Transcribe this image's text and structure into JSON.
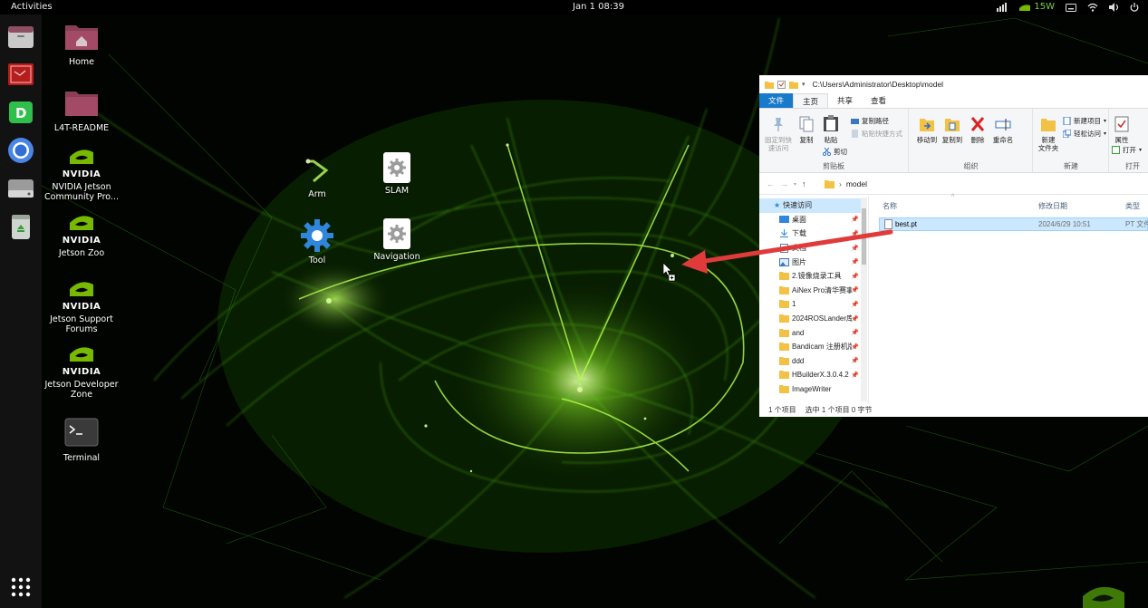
{
  "topbar": {
    "activities": "Activities",
    "clock": "Jan 1  08:39",
    "power_mode": "15W"
  },
  "dock": {
    "items": [
      "file-manager",
      "screenshot-tool",
      "dashboard-app",
      "chromium-browser",
      "drive",
      "trash"
    ],
    "show_apps": "show-apps"
  },
  "desktop": {
    "icons": [
      {
        "label": "Home"
      },
      {
        "label": "L4T-README"
      },
      {
        "label": "NVIDIA Jetson Community Pro..."
      },
      {
        "label": "Jetson Zoo"
      },
      {
        "label": "Jetson Support Forums"
      },
      {
        "label": "Jetson Developer Zone"
      },
      {
        "label": "Terminal"
      }
    ],
    "nvidia_word": "NVIDIA",
    "apps": [
      {
        "label": "Arm"
      },
      {
        "label": "SLAM"
      },
      {
        "label": "Tool"
      },
      {
        "label": "Navigation"
      }
    ]
  },
  "explorer": {
    "title_path": "C:\\Users\\Administrator\\Desktop\\model",
    "tabs": [
      "文件",
      "主页",
      "共享",
      "查看"
    ],
    "ribbon": {
      "pin_quick": "固定到快\n速访问",
      "copy": "复制",
      "paste": "粘贴",
      "copy_path": "复制路径",
      "paste_shortcut": "粘贴快捷方式",
      "cut": "剪切",
      "group_clipboard": "剪贴板",
      "move_to": "移动到",
      "copy_to": "复制到",
      "delete": "删除",
      "rename": "重命名",
      "group_organize": "组织",
      "new_folder": "新建\n文件夹",
      "new_item": "新建项目",
      "easy_access": "轻松访问",
      "group_new": "新建",
      "properties": "属性",
      "open": "打开",
      "group_open": "打开"
    },
    "breadcrumb": "model",
    "nav": {
      "quick_access": "快速访问",
      "items": [
        {
          "label": "桌面"
        },
        {
          "label": "下载"
        },
        {
          "label": "文档"
        },
        {
          "label": "图片"
        },
        {
          "label": "2.镜像烧录工具"
        },
        {
          "label": "AiNex Pro清华赛事"
        },
        {
          "label": "1"
        },
        {
          "label": "2024ROSLander库"
        },
        {
          "label": "and"
        },
        {
          "label": "Bandicam 注册机版"
        },
        {
          "label": "ddd"
        },
        {
          "label": "HBuilderX.3.0.4.2"
        },
        {
          "label": "ImageWriter"
        }
      ]
    },
    "columns": {
      "name": "名称",
      "modified": "修改日期",
      "type": "类型"
    },
    "files": [
      {
        "name": "best.pt",
        "modified": "2024/6/29 10:51",
        "type": "PT 文件"
      }
    ],
    "status": {
      "count": "1 个项目",
      "selected": "选中 1 个项目  0 字节"
    }
  },
  "colors": {
    "nvidia_green": "#76b900",
    "annotation_red": "#e03a3a",
    "ribbon_file_tab": "#1979ca",
    "selection": "#cce8ff"
  }
}
